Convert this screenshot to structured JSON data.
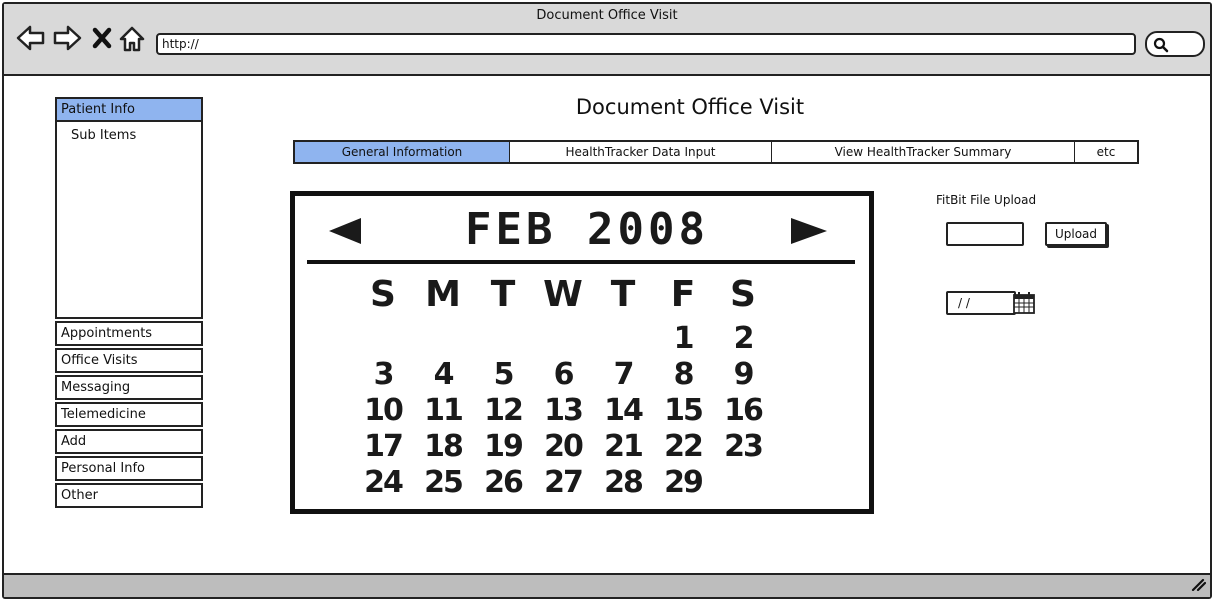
{
  "window": {
    "title": "Document Office Visit"
  },
  "browser": {
    "url": "http://"
  },
  "sidebar": {
    "active": "Patient Info",
    "sub_items": "Sub Items",
    "items": [
      "Appointments",
      "Office Visits",
      "Messaging",
      "Telemedicine",
      "Add",
      "Personal Info",
      "Other"
    ]
  },
  "page": {
    "title": "Document Office Visit"
  },
  "tabs": [
    {
      "label": "General Information",
      "selected": true
    },
    {
      "label": "HealthTracker Data Input",
      "selected": false
    },
    {
      "label": "View HealthTracker Summary",
      "selected": false
    },
    {
      "label": "etc",
      "selected": false
    }
  ],
  "calendar": {
    "month_label": "FEB 2008",
    "weekdays": [
      "S",
      "M",
      "T",
      "W",
      "T",
      "F",
      "S"
    ],
    "days": [
      "",
      "",
      "",
      "",
      "",
      "1",
      "2",
      "3",
      "4",
      "5",
      "6",
      "7",
      "8",
      "9",
      "10",
      "11",
      "12",
      "13",
      "14",
      "15",
      "16",
      "17",
      "18",
      "19",
      "20",
      "21",
      "22",
      "23",
      "24",
      "25",
      "26",
      "27",
      "28",
      "29",
      ""
    ]
  },
  "upload": {
    "label": "FitBit File Upload",
    "button": "Upload",
    "date_placeholder": "/ /"
  },
  "colors": {
    "accent": "#8fb4ef",
    "chrome": "#d9d9d9",
    "statusbar": "#bdbdbd"
  }
}
